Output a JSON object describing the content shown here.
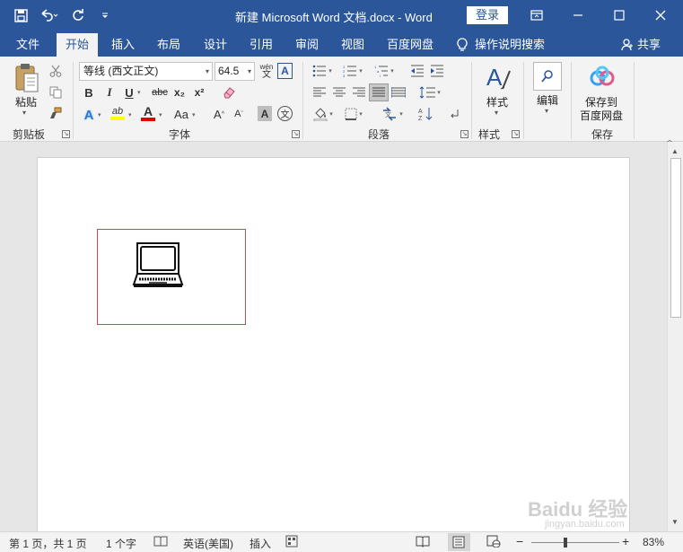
{
  "app": {
    "title": "新建 Microsoft Word 文档.docx  -  Word",
    "login_label": "登录"
  },
  "quick_access": {
    "save_icon": "save-icon",
    "undo_icon": "undo-icon",
    "redo_icon": "redo-icon",
    "customize_icon": "customize-qat-icon"
  },
  "tabs": [
    {
      "label": "文件"
    },
    {
      "label": "开始"
    },
    {
      "label": "插入"
    },
    {
      "label": "布局"
    },
    {
      "label": "设计"
    },
    {
      "label": "引用"
    },
    {
      "label": "审阅"
    },
    {
      "label": "视图"
    },
    {
      "label": "百度网盘"
    }
  ],
  "tell_me": {
    "label": "操作说明搜索"
  },
  "share": {
    "label": "共享"
  },
  "ribbon": {
    "clipboard": {
      "paste_label": "粘贴",
      "group_label": "剪贴板"
    },
    "font": {
      "font_name": "等线 (西文正文)",
      "font_size": "64.5",
      "group_label": "字体",
      "bold": "B",
      "italic": "I",
      "underline": "U",
      "strike": "abc",
      "subscript": "x₂",
      "superscript": "x²",
      "font_color_letter": "A",
      "highlight_letters": "ab",
      "change_case": "Aa",
      "grow_font": "A",
      "shrink_font": "A",
      "char_shading": "A",
      "effects_letter": "A",
      "phonetic": "wén",
      "phonetic_char": "文"
    },
    "paragraph": {
      "group_label": "段落"
    },
    "styles": {
      "styles_label": "样式",
      "group_label": "样式"
    },
    "editing": {
      "label": "编辑"
    },
    "save": {
      "label_line1": "保存到",
      "label_line2": "百度网盘",
      "group_label": "保存"
    }
  },
  "status": {
    "page": "第 1 页，共 1 页",
    "words": "1 个字",
    "language": "英语(美国)",
    "mode": "插入",
    "zoom": "83%",
    "zoom_minus": "−",
    "zoom_plus": "+"
  },
  "colors": {
    "brand": "#2b579a",
    "selection_border": "#c0504d",
    "highlight": "#ffff00",
    "font_color": "#e00000"
  },
  "watermark": {
    "text": "Baidu 经验",
    "sub": "jingyan.baidu.com"
  }
}
